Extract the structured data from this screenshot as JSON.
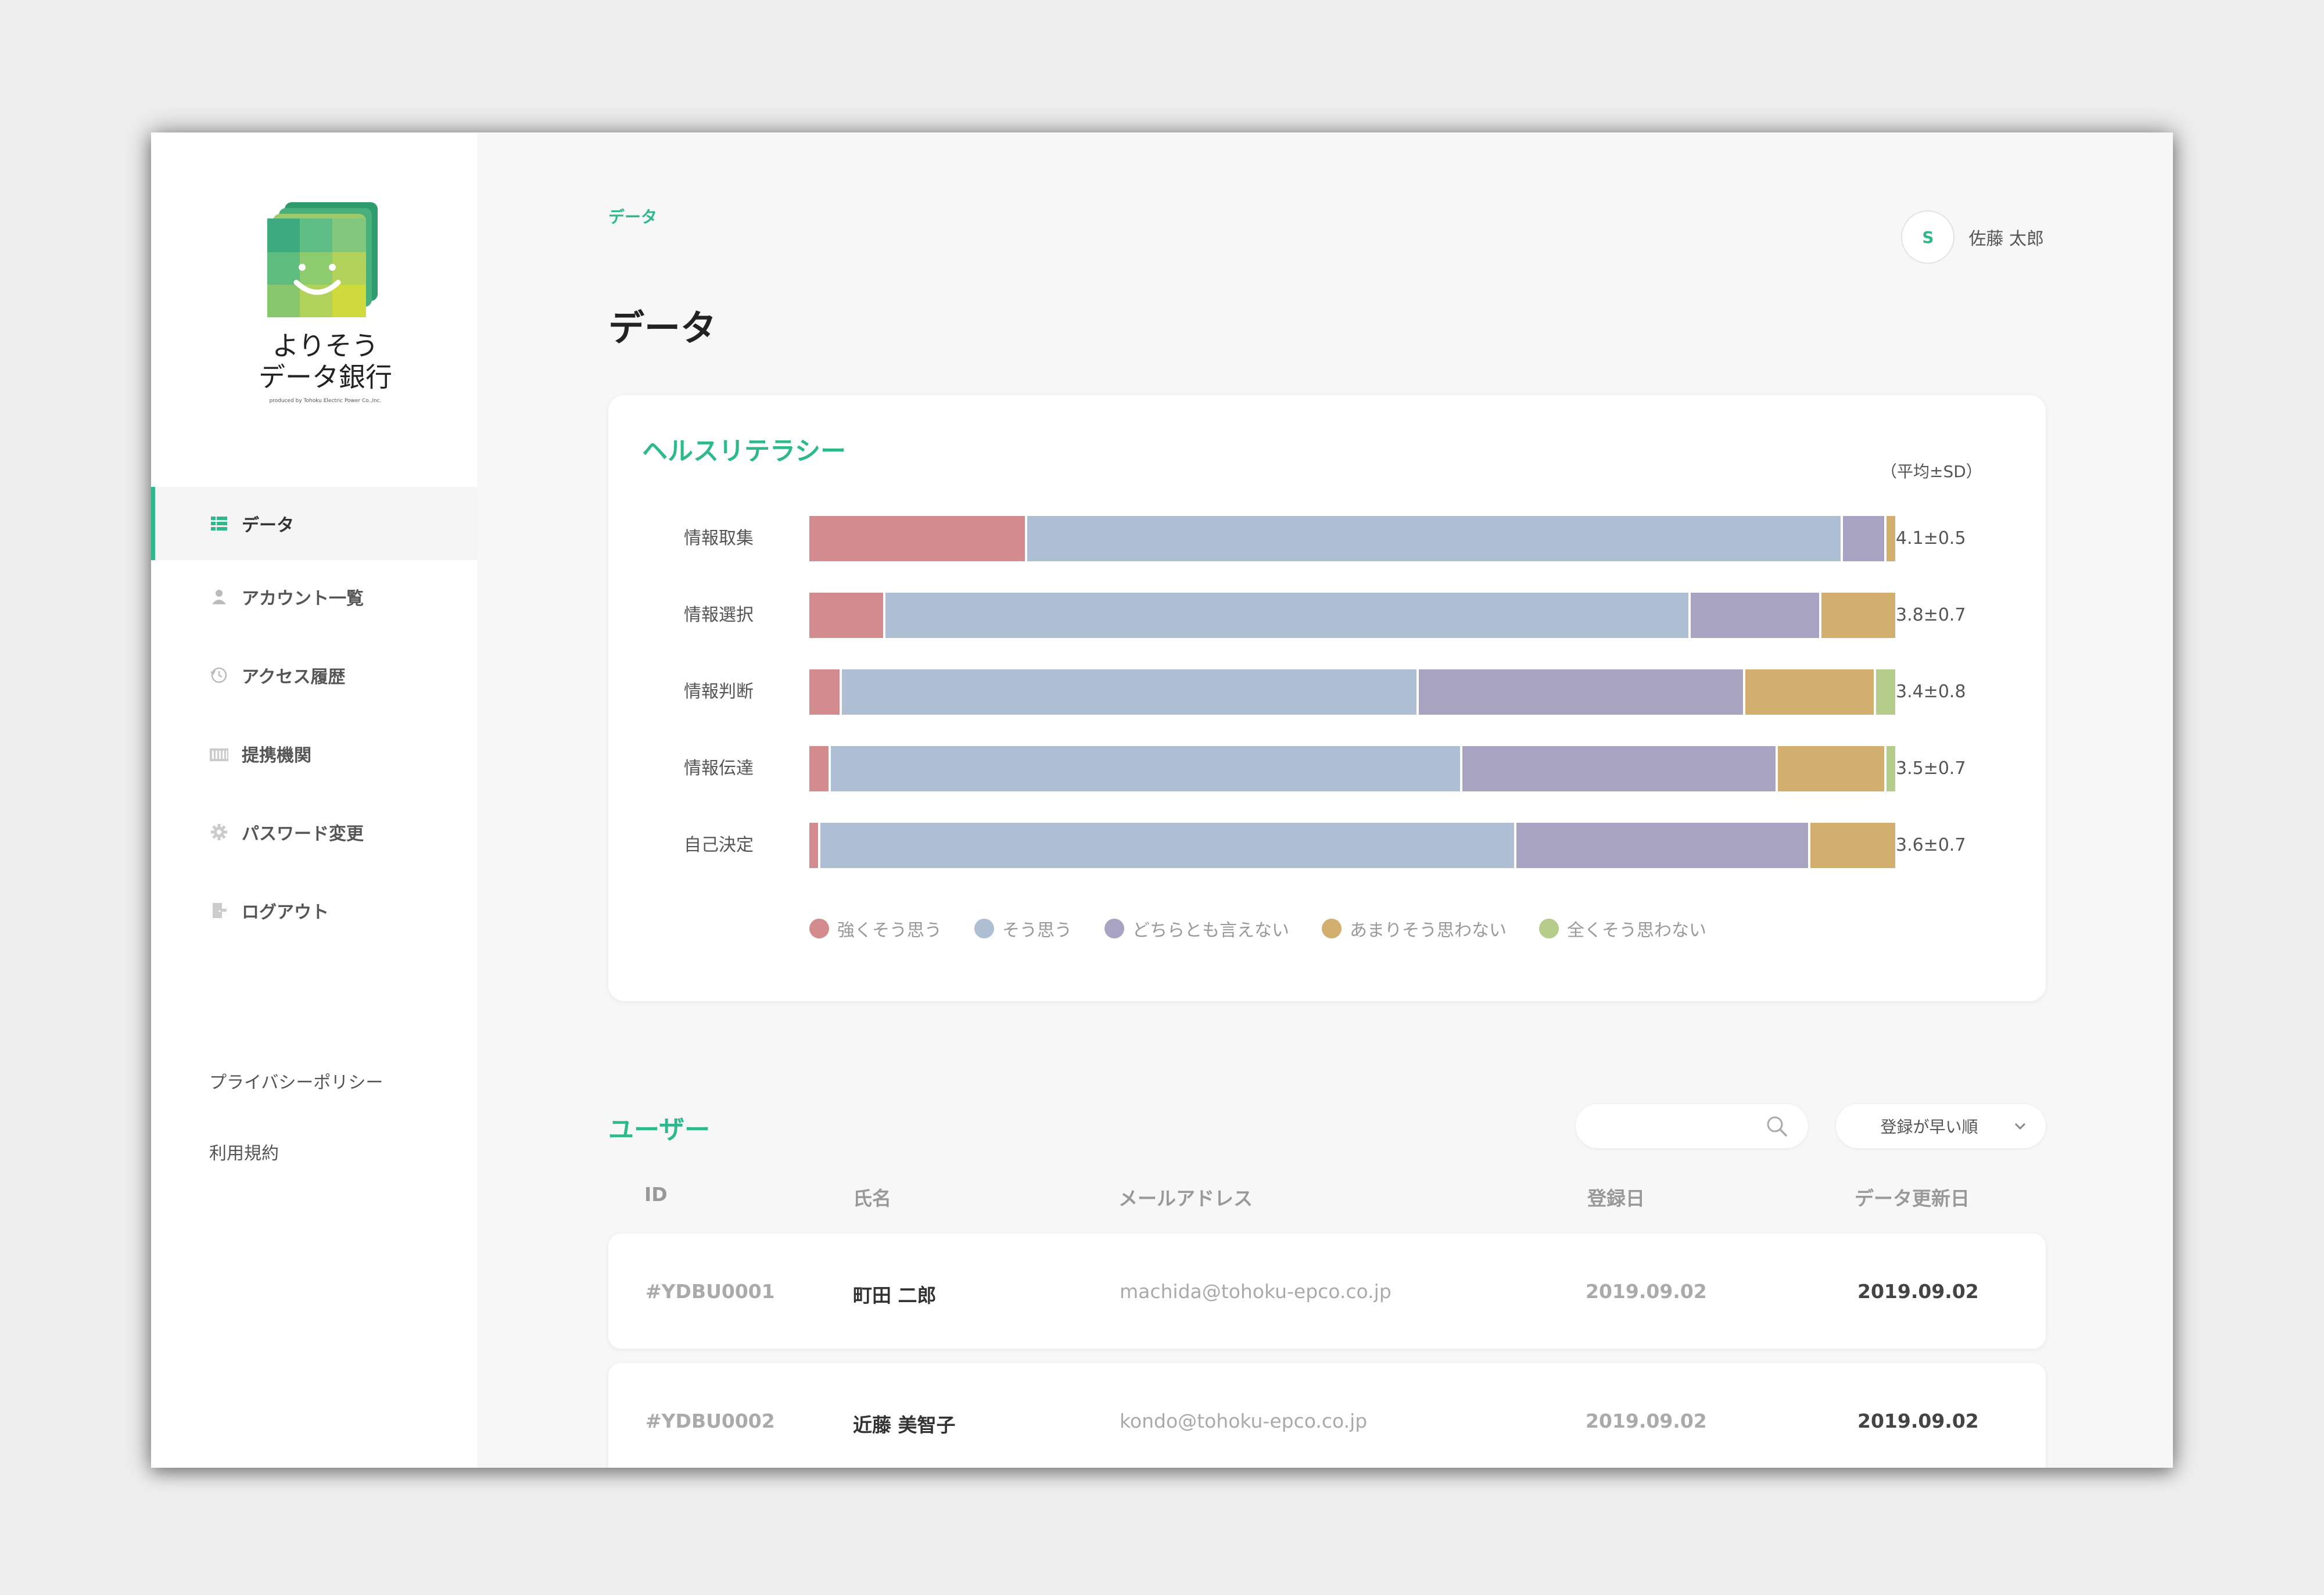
{
  "brand": {
    "name_line1": "よりそう",
    "name_line2": "データ銀行",
    "tagline": "produced by Tohoku Electric Power Co.,Inc."
  },
  "sidebar": {
    "items": [
      {
        "label": "データ",
        "icon": "grid-list-icon",
        "active": true
      },
      {
        "label": "アカウント一覧",
        "icon": "user-icon",
        "active": false
      },
      {
        "label": "アクセス履歴",
        "icon": "history-clock-icon",
        "active": false
      },
      {
        "label": "提携機関",
        "icon": "building-icon",
        "active": false
      },
      {
        "label": "パスワード変更",
        "icon": "gear-icon",
        "active": false
      },
      {
        "label": "ログアウト",
        "icon": "logout-door-icon",
        "active": false
      }
    ],
    "footer_links": [
      "プライバシーポリシー",
      "利用規約"
    ]
  },
  "header": {
    "breadcrumb": "データ",
    "title": "データ",
    "user": {
      "initial": "S",
      "name": "佐藤 太郎"
    }
  },
  "health_card": {
    "title": "ヘルスリテラシー",
    "unit_note": "（平均±SD）"
  },
  "chart_data": {
    "type": "bar",
    "orientation": "horizontal",
    "stacked": true,
    "normalized": true,
    "categories": [
      "情報取集",
      "情報選択",
      "情報判断",
      "情報伝達",
      "自己決定"
    ],
    "series": [
      {
        "name": "強くそう思う",
        "color": "#d48b8e",
        "values": [
          0.2,
          0.07,
          0.03,
          0.02,
          0.01
        ]
      },
      {
        "name": "そう思う",
        "color": "#aebfd4",
        "values": [
          0.75,
          0.74,
          0.53,
          0.58,
          0.64
        ]
      },
      {
        "name": "どちらとも言えない",
        "color": "#a9a3c2",
        "values": [
          0.04,
          0.12,
          0.3,
          0.29,
          0.27
        ]
      },
      {
        "name": "あまりそう思わない",
        "color": "#d2af6e",
        "values": [
          0.01,
          0.07,
          0.12,
          0.1,
          0.08
        ]
      },
      {
        "name": "全くそう思わない",
        "color": "#b5cc8a",
        "values": [
          0.0,
          0.0,
          0.02,
          0.01,
          0.0
        ]
      }
    ],
    "stats": [
      "4.1±0.5",
      "3.8±0.7",
      "3.4±0.8",
      "3.5±0.7",
      "3.6±0.7"
    ],
    "legend_position": "bottom",
    "grid": false
  },
  "users": {
    "title": "ユーザー",
    "search": {
      "value": "",
      "placeholder": "",
      "icon": "search-icon"
    },
    "sort": {
      "selected": "登録が早い順",
      "icon": "chevron-down-icon"
    },
    "columns": [
      "ID",
      "氏名",
      "メールアドレス",
      "登録日",
      "データ更新日"
    ],
    "rows": [
      {
        "id": "#YDBU0001",
        "name": "町田 二郎",
        "email": "machida@tohoku-epco.co.jp",
        "registered": "2019.09.02",
        "updated": "2019.09.02"
      },
      {
        "id": "#YDBU0002",
        "name": "近藤 美智子",
        "email": "kondo@tohoku-epco.co.jp",
        "registered": "2019.09.02",
        "updated": "2019.09.02"
      }
    ]
  },
  "colors": {
    "accent": "#2fb98a",
    "background": "#eeeeee",
    "card": "#ffffff"
  }
}
